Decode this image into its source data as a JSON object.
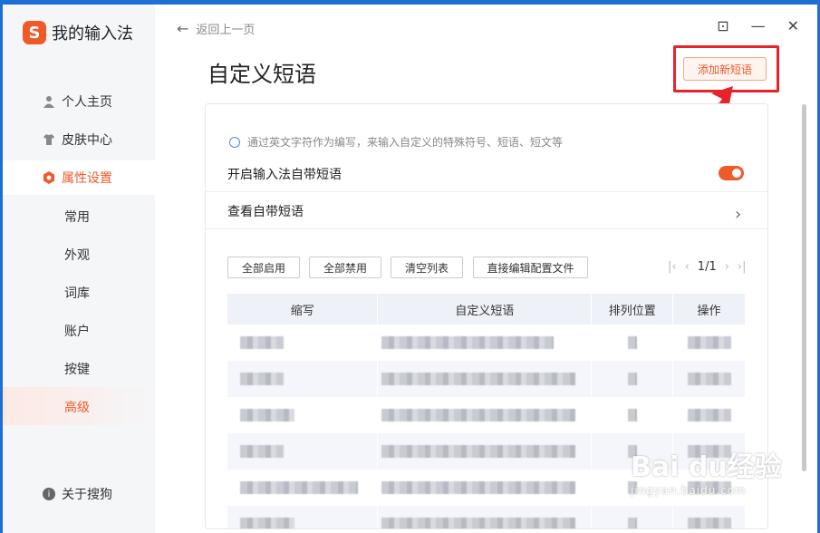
{
  "app": {
    "logo_glyph": "S",
    "title": "我的输入法"
  },
  "sidebar": {
    "items": [
      {
        "label": "个人主页",
        "icon": "user-icon"
      },
      {
        "label": "皮肤中心",
        "icon": "tshirt-icon"
      },
      {
        "label": "属性设置",
        "icon": "hexagon-gear-icon"
      }
    ],
    "subitems": [
      "常用",
      "外观",
      "词库",
      "账户",
      "按键",
      "高级"
    ],
    "about": "关于搜狗"
  },
  "topbar": {
    "back_label": "返回上一页",
    "back_arrow": "←",
    "feedback_icon": "⊡",
    "minimize": "—",
    "close": "✕"
  },
  "page": {
    "title": "自定义短语",
    "add_button": "添加新短语",
    "tip": "通过英文字符作为编写，来输入自定义的特殊符号、短语、短文等",
    "enable_label": "开启输入法自带短语",
    "view_label": "查看自带短语",
    "chevron": "›",
    "buttons": [
      "全部启用",
      "全部禁用",
      "清空列表",
      "直接编辑配置文件"
    ],
    "pager": {
      "first": "|‹",
      "prev": "‹",
      "page": "1/1",
      "next": "›",
      "last": "›|"
    },
    "columns": [
      "缩写",
      "自定义短语",
      "排列位置",
      "操作"
    ]
  },
  "watermark": {
    "main": "Bai du经验",
    "sub": "jingyan.baidu.com"
  },
  "colors": {
    "accent": "#f05a28",
    "annotation_red": "#e8222b"
  }
}
